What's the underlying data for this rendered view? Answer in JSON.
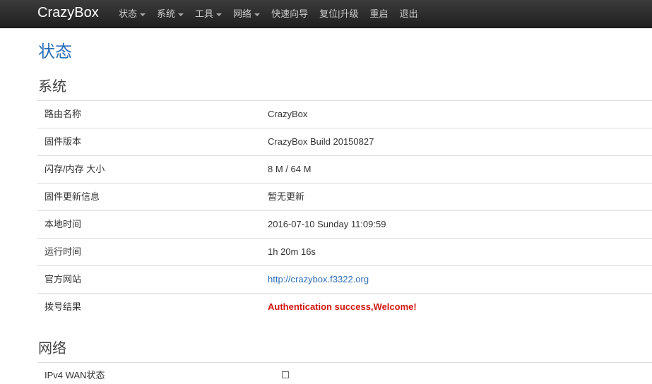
{
  "brand": "CrazyBox",
  "nav": [
    {
      "label": "状态",
      "dropdown": true
    },
    {
      "label": "系统",
      "dropdown": true
    },
    {
      "label": "工具",
      "dropdown": true
    },
    {
      "label": "网络",
      "dropdown": true
    },
    {
      "label": "快速向导",
      "dropdown": false
    },
    {
      "label": "复位|升级",
      "dropdown": false
    },
    {
      "label": "重启",
      "dropdown": false
    },
    {
      "label": "退出",
      "dropdown": false
    }
  ],
  "page_title": "状态",
  "system": {
    "title": "系统",
    "rows": [
      {
        "label": "路由名称",
        "value": "CrazyBox"
      },
      {
        "label": "固件版本",
        "value": "CrazyBox Build 20150827"
      },
      {
        "label": "闪存/内存 大小",
        "value": "8 M / 64 M"
      },
      {
        "label": "固件更新信息",
        "value": "暂无更新"
      },
      {
        "label": "本地时间",
        "value": "2016-07-10 Sunday 11:09:59"
      },
      {
        "label": "运行时间",
        "value": "1h 20m 16s"
      },
      {
        "label": "官方网站",
        "value": "http://crazybox.f3322.org"
      },
      {
        "label": "拨号结果",
        "value": "Authentication success,Welcome!"
      }
    ]
  },
  "network": {
    "title": "网络",
    "rows": [
      {
        "label": "IPv4 WAN状态"
      }
    ]
  },
  "colors": {
    "navbar": "#2a2a2a",
    "title_blue": "#2c6eb5",
    "alert_red": "#d2160f"
  }
}
